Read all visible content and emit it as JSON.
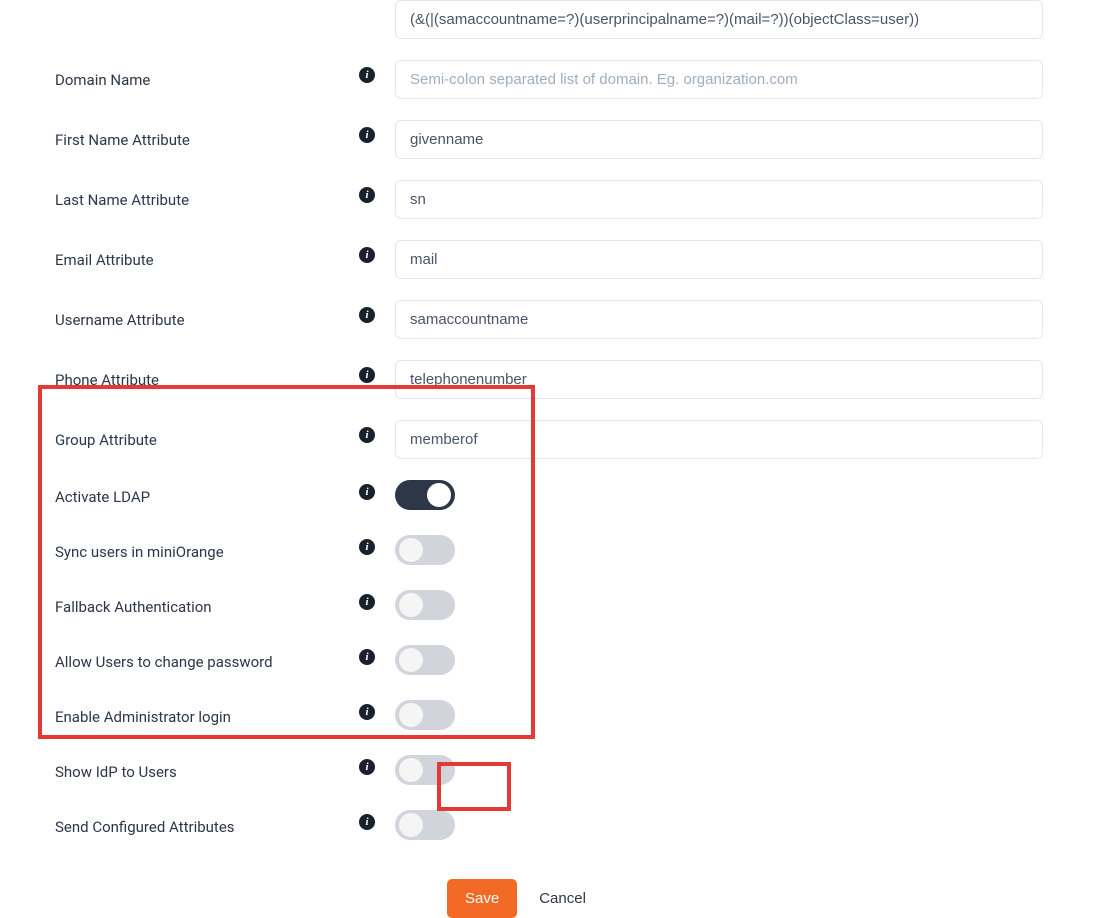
{
  "fields": {
    "filter": {
      "value": "(&(|(samaccountname=?)(userprincipalname=?)(mail=?))(objectClass=user))"
    },
    "domain_name": {
      "label": "Domain Name",
      "placeholder": "Semi-colon separated list of domain. Eg. organization.com",
      "value": ""
    },
    "first_name": {
      "label": "First Name Attribute",
      "value": "givenname"
    },
    "last_name": {
      "label": "Last Name Attribute",
      "value": "sn"
    },
    "email": {
      "label": "Email Attribute",
      "value": "mail"
    },
    "username": {
      "label": "Username Attribute",
      "value": "samaccountname"
    },
    "phone": {
      "label": "Phone Attribute",
      "value": "telephonenumber"
    },
    "group": {
      "label": "Group Attribute",
      "value": "memberof"
    }
  },
  "toggles": {
    "activate_ldap": {
      "label": "Activate LDAP",
      "on": true
    },
    "sync_users": {
      "label": "Sync users in miniOrange",
      "on": false
    },
    "fallback_auth": {
      "label": "Fallback Authentication",
      "on": false
    },
    "allow_change_pw": {
      "label": "Allow Users to change password",
      "on": false
    },
    "enable_admin_login": {
      "label": "Enable Administrator login",
      "on": false
    },
    "show_idp": {
      "label": "Show IdP to Users",
      "on": false
    },
    "send_attrs": {
      "label": "Send Configured Attributes",
      "on": false
    }
  },
  "buttons": {
    "save": "Save",
    "cancel": "Cancel"
  }
}
